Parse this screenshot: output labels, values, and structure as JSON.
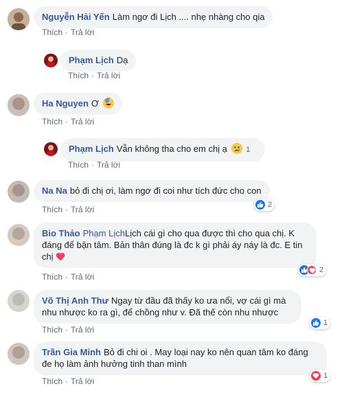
{
  "comments": [
    {
      "author": "Nguyễn Hải Yến",
      "text": "Làm ngơ đi Lịch .... nhẹ nhàng cho qia",
      "like_label": "Thích",
      "reply_label": "Trả lời"
    },
    {
      "author": "Phạm Lịch",
      "text": "Dạ",
      "like_label": "Thích",
      "reply_label": "Trả lời"
    },
    {
      "author": "Ha Nguyen",
      "text": "Ơ",
      "emoji": "smiley-emoji",
      "like_label": "Thích",
      "reply_label": "Trả lời"
    },
    {
      "author": "Phạm Lịch",
      "text": "Vẫn không tha cho em chị ạ",
      "emoji": "sad-emoji",
      "like_label": "Thích",
      "reply_label": "Trả lời",
      "reaction_count": "1"
    },
    {
      "author": "Na Na",
      "text": "bỏ đi chị ơi, làm ngơ đi coi như tích đức cho con",
      "like_label": "Thích",
      "reply_label": "Trả lời",
      "reaction_icon": "like-icon",
      "reaction_count": "2"
    },
    {
      "author": "Bio Thảo",
      "tag": "Phạm Lịch",
      "text": "Lịch cái gì cho qua được thì cho qua chị. K đáng để bận tâm. Bản thân đúng là đc k gì phải áy náy là đc. E tin chị",
      "emoji": "heart-emoji",
      "like_label": "Thích",
      "reply_label": "Trả lời",
      "reaction_icon": "like-love-icons",
      "reaction_count": "2"
    },
    {
      "author": "Võ Thị Anh Thư",
      "text": "Ngay từ đầu đã thấy ko ưa nổi, vợ cái gì mà nhu nhược ko ra gì, để chồng như v. Đã thế còn nhu nhược",
      "like_label": "Thích",
      "reply_label": "Trả lời",
      "reaction_icon": "like-icon",
      "reaction_count": "1"
    },
    {
      "author": "Trần Gia Minh",
      "text": "Bỏ đi chi oi . May loại nay ko nên quan tâm ko đáng đe họ làm ảnh hưởng tinh than mình",
      "like_label": "Thích",
      "reply_label": "Trả lời",
      "reaction_icon": "love-icon",
      "reaction_count": "1"
    }
  ],
  "colors": {
    "author": "#385898",
    "bubble": "#f2f3f5",
    "like": "#1877f2",
    "love": "#f33e58",
    "meta": "#606770"
  }
}
